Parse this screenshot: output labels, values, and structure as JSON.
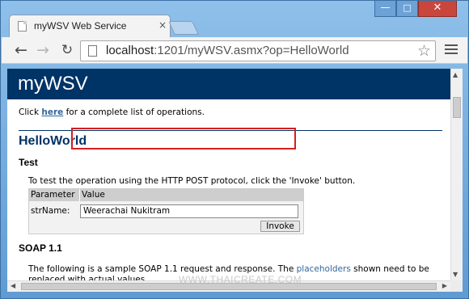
{
  "window": {
    "minimize_glyph": "—",
    "maximize_glyph": "□",
    "close_glyph": "✕"
  },
  "tab": {
    "title": "myWSV Web Service",
    "close_glyph": "×",
    "favicon": "page-icon"
  },
  "toolbar": {
    "back_glyph": "←",
    "forward_glyph": "→",
    "reload_glyph": "↻",
    "url_host": "localhost",
    "url_rest": ":1201/myWSV.asmx?op=HelloWorld",
    "bookmark_glyph": "☆"
  },
  "page": {
    "service_name": "myWSV",
    "intro_before": "Click ",
    "intro_link": "here",
    "intro_after": " for a complete list of operations.",
    "operation": "HelloWorld",
    "test_heading": "Test",
    "test_text": "To test the operation using the HTTP POST protocol, click the 'Invoke' button.",
    "param_header": "Parameter",
    "value_header": "Value",
    "param_name": "strName:",
    "param_value": "Weerachai Nukitram",
    "invoke_label": "Invoke",
    "soap_heading": "SOAP 1.1",
    "soap_text_1": "The following is a sample SOAP 1.1 request and response. The ",
    "soap_placeholders": "placeholders",
    "soap_text_2": " shown need to be replaced with actual values."
  },
  "watermark": "WWW.THAICREATE.COM",
  "colors": {
    "header_bg": "#003366",
    "link": "#336699",
    "highlight": "#d61f1f"
  }
}
